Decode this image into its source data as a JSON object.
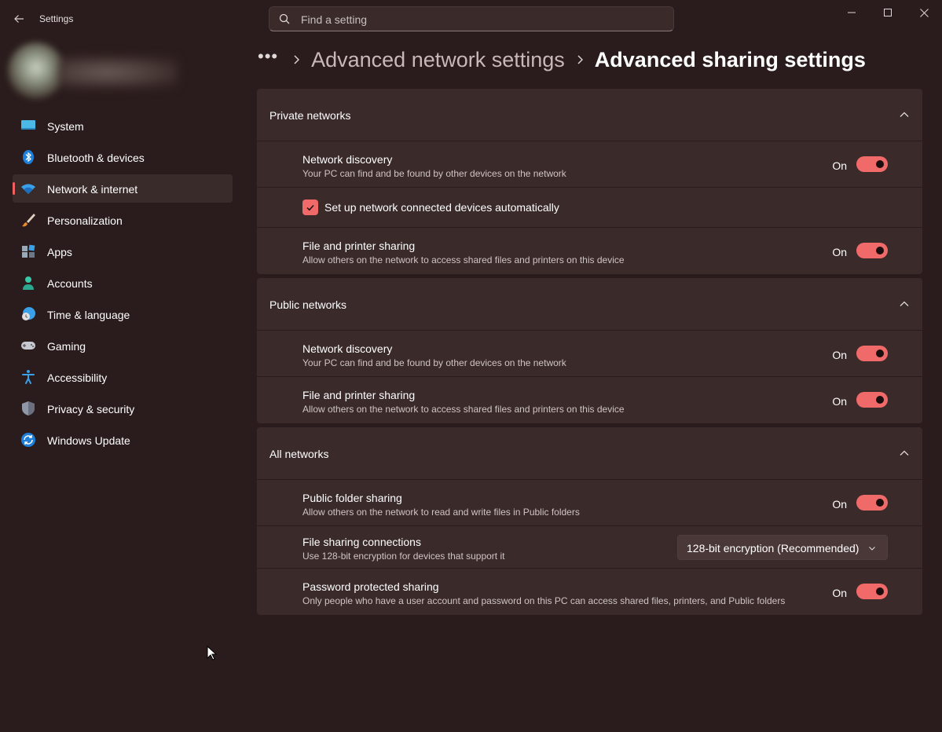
{
  "app": {
    "title": "Settings"
  },
  "search": {
    "placeholder": "Find a setting"
  },
  "sidebar": {
    "items": [
      {
        "label": "System",
        "icon": "monitor-icon",
        "active": false
      },
      {
        "label": "Bluetooth & devices",
        "icon": "bluetooth-icon",
        "active": false
      },
      {
        "label": "Network & internet",
        "icon": "wifi-icon",
        "active": true
      },
      {
        "label": "Personalization",
        "icon": "brush-icon",
        "active": false
      },
      {
        "label": "Apps",
        "icon": "apps-icon",
        "active": false
      },
      {
        "label": "Accounts",
        "icon": "person-icon",
        "active": false
      },
      {
        "label": "Time & language",
        "icon": "globe-clock-icon",
        "active": false
      },
      {
        "label": "Gaming",
        "icon": "gamepad-icon",
        "active": false
      },
      {
        "label": "Accessibility",
        "icon": "accessibility-icon",
        "active": false
      },
      {
        "label": "Privacy & security",
        "icon": "shield-icon",
        "active": false
      },
      {
        "label": "Windows Update",
        "icon": "update-icon",
        "active": false
      }
    ]
  },
  "breadcrumb": {
    "more": "•••",
    "parent": "Advanced network settings",
    "current": "Advanced sharing settings"
  },
  "sections": {
    "private": {
      "title": "Private networks",
      "network_discovery": {
        "title": "Network discovery",
        "subtitle": "Your PC can find and be found by other devices on the network",
        "state": "On"
      },
      "auto_setup": {
        "label": "Set up network connected devices automatically",
        "checked": true
      },
      "file_printer": {
        "title": "File and printer sharing",
        "subtitle": "Allow others on the network to access shared files and printers on this device",
        "state": "On"
      }
    },
    "public": {
      "title": "Public networks",
      "network_discovery": {
        "title": "Network discovery",
        "subtitle": "Your PC can find and be found by other devices on the network",
        "state": "On"
      },
      "file_printer": {
        "title": "File and printer sharing",
        "subtitle": "Allow others on the network to access shared files and printers on this device",
        "state": "On"
      }
    },
    "all": {
      "title": "All networks",
      "public_folder": {
        "title": "Public folder sharing",
        "subtitle": "Allow others on the network to read and write files in Public folders",
        "state": "On"
      },
      "file_sharing_conn": {
        "title": "File sharing connections",
        "subtitle": "Use 128-bit encryption for devices that support it",
        "selected": "128-bit encryption (Recommended)"
      },
      "password_sharing": {
        "title": "Password protected sharing",
        "subtitle": "Only people who have a user account and password on this PC can access shared files, printers, and Public folders",
        "state": "On"
      }
    }
  },
  "colors": {
    "accent": "#f06a6a",
    "background": "#2a1c1c",
    "card": "#3a2a2a"
  }
}
